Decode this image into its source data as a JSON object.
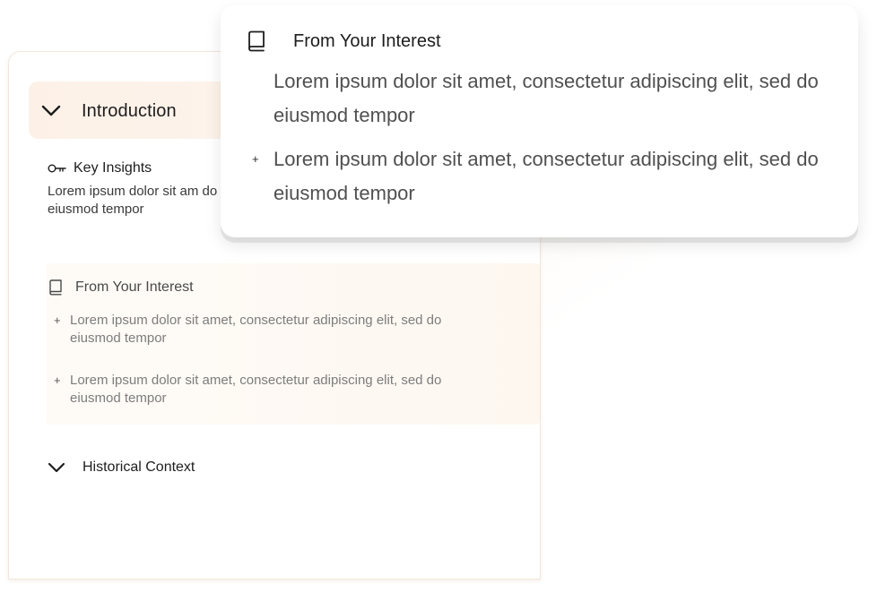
{
  "colors": {
    "accent_bg": "#fdf1e7",
    "text_primary": "#1d1d1d",
    "text_muted": "#7d7d7d",
    "card_border": "#f3e6dc"
  },
  "icons": {
    "intro_toggle": "chevron-down-icon",
    "insights": "key-icon",
    "interest": "book-icon",
    "history_toggle": "chevron-down-icon",
    "bullet": "plus-icon"
  },
  "card": {
    "intro": {
      "label": "Introduction"
    },
    "insights": {
      "title": "Key Insights",
      "body": "Lorem ipsum dolor sit am do eiusmod tempor"
    },
    "interest": {
      "title": "From Your Interest",
      "items": [
        {
          "bullet": "+",
          "text": "Lorem ipsum dolor sit amet, consectetur adipiscing elit, sed do eiusmod tempor"
        },
        {
          "bullet": "+",
          "text": "Lorem ipsum dolor sit amet, consectetur adipiscing elit, sed do eiusmod tempor"
        }
      ]
    },
    "history": {
      "label": "Historical Context"
    }
  },
  "popup": {
    "title": "From Your Interest",
    "items": [
      {
        "bullet": "",
        "text": "Lorem ipsum dolor sit amet, consectetur adipiscing elit, sed do eiusmod tempor"
      },
      {
        "bullet": "+",
        "text": "Lorem ipsum dolor sit amet, consectetur adipiscing elit, sed do eiusmod tempor"
      }
    ]
  }
}
